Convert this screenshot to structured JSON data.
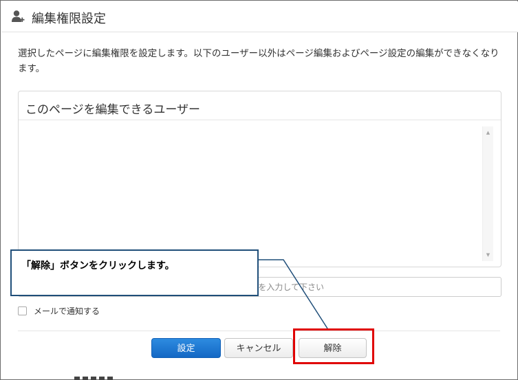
{
  "dialog": {
    "title": "編集権限設定",
    "description": "選択したページに編集権限を設定します。以下のユーザー以外はページ編集およびページ設定の編集ができなくなります。",
    "editors_panel": {
      "title": "このページを編集できるユーザー",
      "users": []
    },
    "user_input": {
      "visible_placeholder": "を入力して下さい"
    },
    "notify": {
      "label": "メールで通知する",
      "checked": false
    },
    "buttons": {
      "set": "設定",
      "cancel": "キャンセル",
      "remove": "解除"
    }
  },
  "annotation": {
    "callout_text": "「解除」ボタンをクリックします。",
    "highlight_color": "#e00000",
    "callout_border_color": "#1f4e79"
  },
  "colors": {
    "primary": "#1468c4",
    "border": "#d8d8d8"
  },
  "icons": {
    "title_icon": "user-add-icon",
    "scroll_up": "scroll-up-arrow-icon",
    "scroll_down": "scroll-down-arrow-icon"
  }
}
